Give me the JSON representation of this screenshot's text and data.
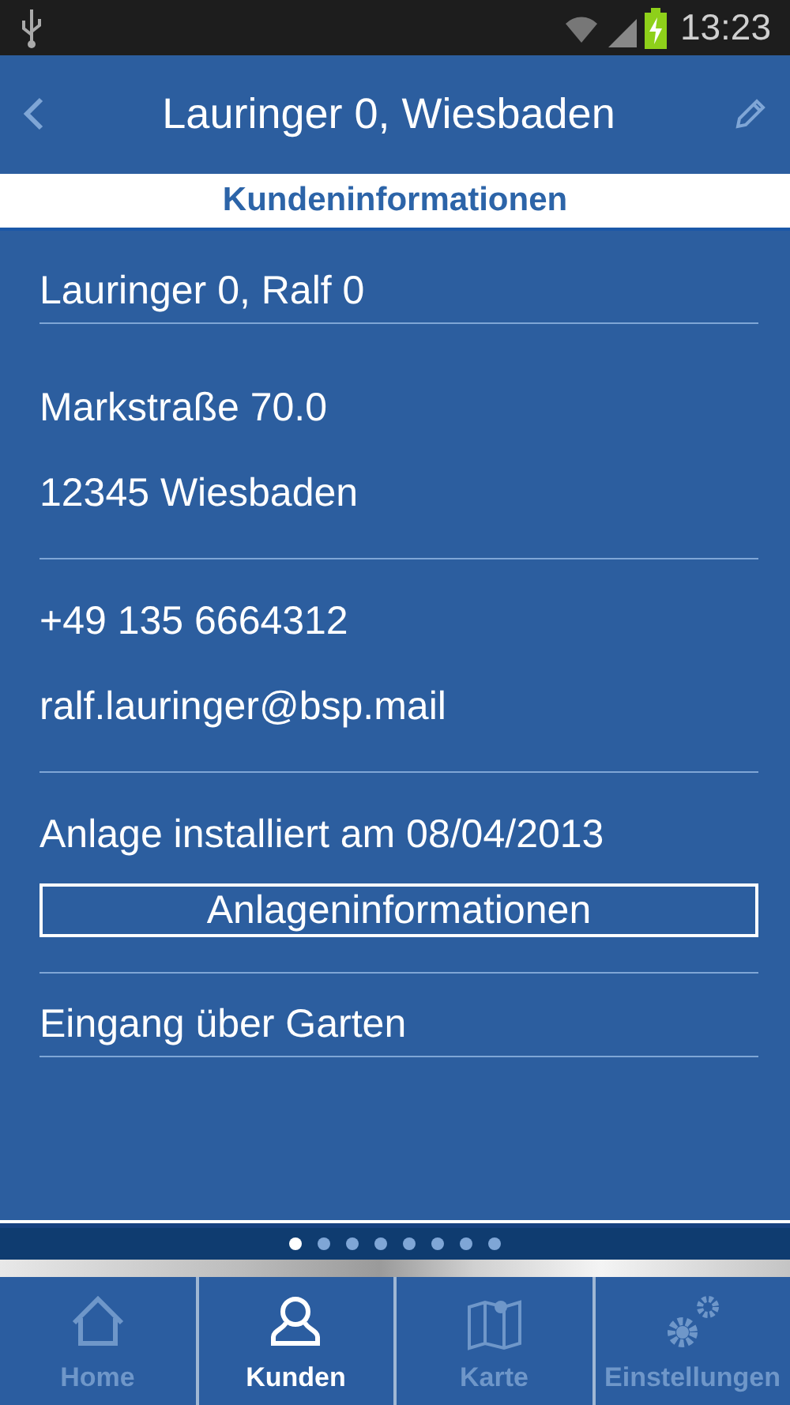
{
  "status_bar": {
    "time": "13:23"
  },
  "header": {
    "title": "Lauringer 0, Wiesbaden"
  },
  "subtitle": "Kundeninformationen",
  "sections": [
    {
      "rows": [
        {
          "kind": "text",
          "text": "Lauringer 0, Ralf 0",
          "underlined": true
        }
      ]
    },
    {
      "rows": [
        {
          "kind": "text",
          "text": "Markstraße 70.0",
          "underlined": false
        },
        {
          "kind": "text",
          "text": "12345 Wiesbaden",
          "underlined": false
        }
      ]
    },
    {
      "rows": [
        {
          "kind": "text",
          "text": "+49 135 6664312",
          "underlined": false
        },
        {
          "kind": "text",
          "text": "ralf.lauringer@bsp.mail",
          "underlined": false
        }
      ]
    },
    {
      "rows": [
        {
          "kind": "text",
          "text": "Anlage installiert am 08/04/2013",
          "underlined": false
        },
        {
          "kind": "button",
          "text": "Anlageninformationen"
        }
      ]
    },
    {
      "rows": [
        {
          "kind": "text",
          "text": "Eingang über Garten",
          "underlined": true
        }
      ]
    }
  ],
  "page_dots": [
    {
      "selected": true
    },
    {
      "selected": false
    },
    {
      "selected": false
    },
    {
      "selected": false
    },
    {
      "selected": false
    },
    {
      "selected": false
    },
    {
      "selected": false
    },
    {
      "selected": false
    }
  ],
  "tabs": [
    {
      "label": "Home",
      "kind": "home",
      "selected": false
    },
    {
      "label": "Kunden",
      "kind": "person",
      "selected": true
    },
    {
      "label": "Karte",
      "kind": "map",
      "selected": false
    },
    {
      "label": "Einstellungen",
      "kind": "gears",
      "selected": false
    }
  ]
}
